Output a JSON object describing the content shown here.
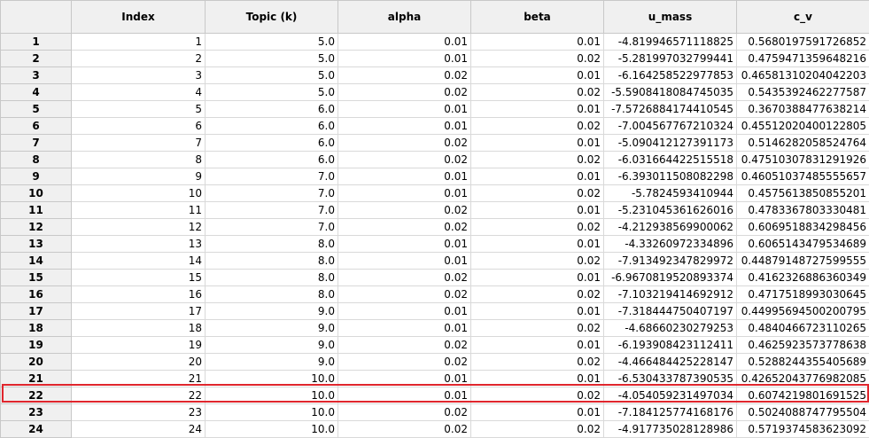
{
  "table": {
    "corner": "",
    "columns": [
      "Index",
      "Topic (k)",
      "alpha",
      "beta",
      "u_mass",
      "c_v"
    ],
    "rows": [
      {
        "row": "1",
        "cells": [
          "1",
          "5.0",
          "0.01",
          "0.01",
          "-4.819946571118825",
          "0.5680197591726852"
        ]
      },
      {
        "row": "2",
        "cells": [
          "2",
          "5.0",
          "0.01",
          "0.02",
          "-5.281997032799441",
          "0.4759471359648216"
        ]
      },
      {
        "row": "3",
        "cells": [
          "3",
          "5.0",
          "0.02",
          "0.01",
          "-6.164258522977853",
          "0.46581310204042203"
        ]
      },
      {
        "row": "4",
        "cells": [
          "4",
          "5.0",
          "0.02",
          "0.02",
          "-5.5908418084745035",
          "0.5435392462277587"
        ]
      },
      {
        "row": "5",
        "cells": [
          "5",
          "6.0",
          "0.01",
          "0.01",
          "-7.5726884174410545",
          "0.3670388477638214"
        ]
      },
      {
        "row": "6",
        "cells": [
          "6",
          "6.0",
          "0.01",
          "0.02",
          "-7.004567767210324",
          "0.45512020400122805"
        ]
      },
      {
        "row": "7",
        "cells": [
          "7",
          "6.0",
          "0.02",
          "0.01",
          "-5.090412127391173",
          "0.5146282058524764"
        ]
      },
      {
        "row": "8",
        "cells": [
          "8",
          "6.0",
          "0.02",
          "0.02",
          "-6.031664422515518",
          "0.47510307831291926"
        ]
      },
      {
        "row": "9",
        "cells": [
          "9",
          "7.0",
          "0.01",
          "0.01",
          "-6.393011508082298",
          "0.46051037485555657"
        ]
      },
      {
        "row": "10",
        "cells": [
          "10",
          "7.0",
          "0.01",
          "0.02",
          "-5.7824593410944",
          "0.4575613850855201"
        ]
      },
      {
        "row": "11",
        "cells": [
          "11",
          "7.0",
          "0.02",
          "0.01",
          "-5.231045361626016",
          "0.4783367803330481"
        ]
      },
      {
        "row": "12",
        "cells": [
          "12",
          "7.0",
          "0.02",
          "0.02",
          "-4.212938569900062",
          "0.6069518834298456"
        ]
      },
      {
        "row": "13",
        "cells": [
          "13",
          "8.0",
          "0.01",
          "0.01",
          "-4.33260972334896",
          "0.6065143479534689"
        ]
      },
      {
        "row": "14",
        "cells": [
          "14",
          "8.0",
          "0.01",
          "0.02",
          "-7.913492347829972",
          "0.44879148727599555"
        ]
      },
      {
        "row": "15",
        "cells": [
          "15",
          "8.0",
          "0.02",
          "0.01",
          "-6.9670819520893374",
          "0.4162326886360349"
        ]
      },
      {
        "row": "16",
        "cells": [
          "16",
          "8.0",
          "0.02",
          "0.02",
          "-7.103219414692912",
          "0.4717518993030645"
        ]
      },
      {
        "row": "17",
        "cells": [
          "17",
          "9.0",
          "0.01",
          "0.01",
          "-7.318444750407197",
          "0.44995694500200795"
        ]
      },
      {
        "row": "18",
        "cells": [
          "18",
          "9.0",
          "0.01",
          "0.02",
          "-4.68660230279253",
          "0.4840466723110265"
        ]
      },
      {
        "row": "19",
        "cells": [
          "19",
          "9.0",
          "0.02",
          "0.01",
          "-6.193908423112411",
          "0.4625923573778638"
        ]
      },
      {
        "row": "20",
        "cells": [
          "20",
          "9.0",
          "0.02",
          "0.02",
          "-4.466484425228147",
          "0.5288244355405689"
        ]
      },
      {
        "row": "21",
        "cells": [
          "21",
          "10.0",
          "0.01",
          "0.01",
          "-6.530433787390535",
          "0.42652043776982085"
        ]
      },
      {
        "row": "22",
        "cells": [
          "22",
          "10.0",
          "0.01",
          "0.02",
          "-4.054059231497034",
          "0.6074219801691525"
        ]
      },
      {
        "row": "23",
        "cells": [
          "23",
          "10.0",
          "0.02",
          "0.01",
          "-7.184125774168176",
          "0.5024088747795504"
        ]
      },
      {
        "row": "24",
        "cells": [
          "24",
          "10.0",
          "0.02",
          "0.02",
          "-4.917735028128986",
          "0.5719374583623092"
        ]
      }
    ],
    "highlighted_row": "22",
    "highlight_color": "#e0262d",
    "header_bg": "#f0f0f0",
    "grid_color": "#d9d9d9"
  }
}
